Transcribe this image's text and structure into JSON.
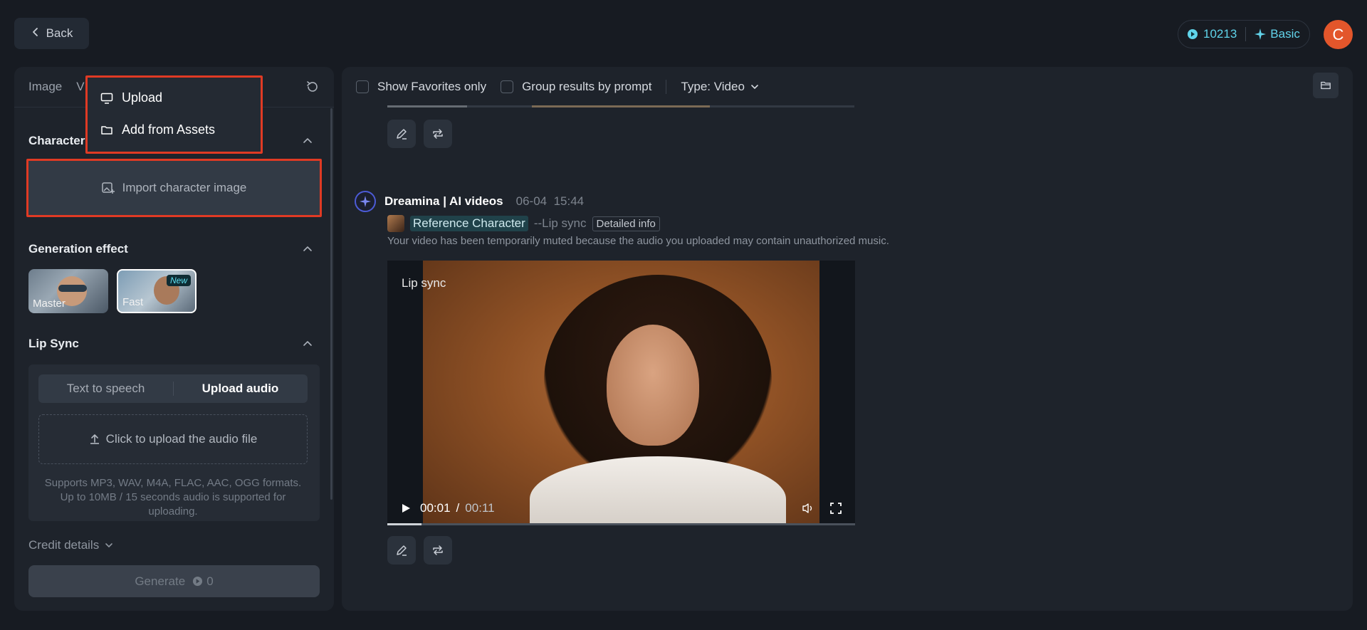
{
  "header": {
    "back_label": "Back",
    "credits": "10213",
    "plan": "Basic",
    "avatar_letter": "C"
  },
  "left": {
    "tabs": [
      "Image",
      "V"
    ],
    "character_title": "Character",
    "import_label": "Import character image",
    "generation_title": "Generation effect",
    "effects": [
      {
        "label": "Master"
      },
      {
        "label": "Fast",
        "badge": "New"
      }
    ],
    "lipsync_title": "Lip Sync",
    "segment": {
      "left": "Text to speech",
      "right": "Upload audio"
    },
    "upload_audio_label": "Click to upload the audio file",
    "support_text": "Supports MP3, WAV, M4A, FLAC, AAC, OGG formats. Up to 10MB / 15 seconds audio is supported for uploading.",
    "credit_details": "Credit details",
    "generate_label": "Generate",
    "generate_cost": "0"
  },
  "dropdown": {
    "upload": "Upload",
    "add_assets": "Add from Assets"
  },
  "right": {
    "show_favorites": "Show Favorites only",
    "group_results": "Group results by prompt",
    "type_filter": "Type: Video",
    "post": {
      "author": "Dreamina | AI videos",
      "date": "06-04",
      "time": "15:44",
      "ref_character": "Reference Character",
      "mode_tag": "--Lip sync",
      "detailed_info": "Detailed info",
      "muted_note": "Your video has been temporarily muted because the audio you uploaded may contain unauthorized music.",
      "video_label": "Lip sync",
      "current_time": "00:01",
      "time_sep": "/",
      "duration": "00:11"
    }
  }
}
